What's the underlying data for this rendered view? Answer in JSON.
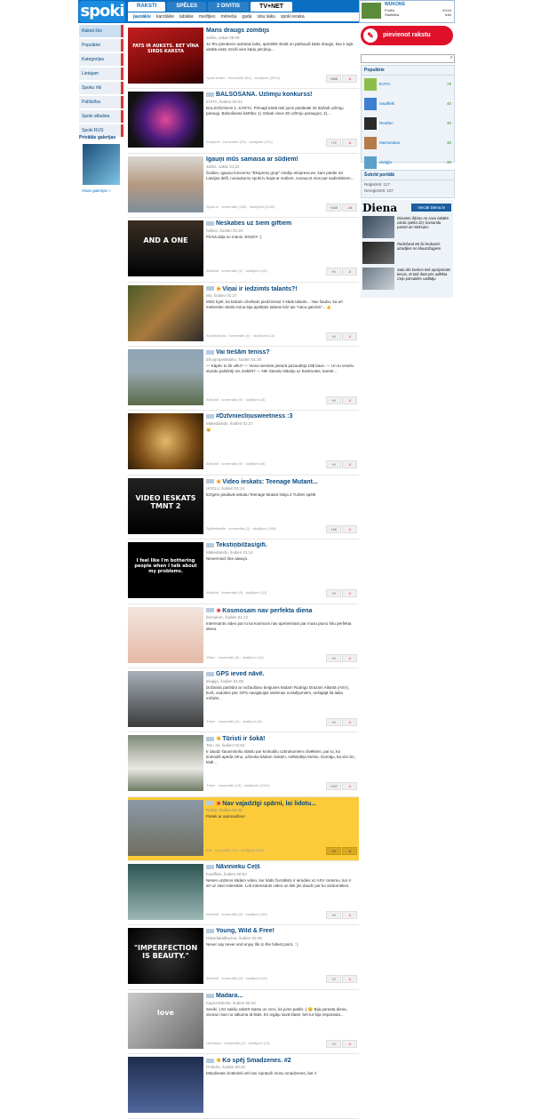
{
  "header": {
    "logo": "spoki",
    "tabs": [
      "RAKSTI",
      "SPĒLES",
      "2 DIVITIS",
      "TV+NET"
    ],
    "subnav": [
      "jaunākie",
      "karstākie",
      "labākie",
      "medījies",
      "mēneša",
      "gada",
      "visu laiku",
      "spoki ieraka"
    ],
    "user": {
      "name": "WUKONS",
      "links": [
        "Profils",
        "Statistika"
      ],
      "count": "6/116",
      "exit": "Iziet"
    }
  },
  "sidebar": {
    "items": [
      "Raksti šīsi",
      "Populārie",
      "Kategorijas",
      "Lietajam",
      "Spoku rīki",
      "Palīdzība",
      "Spoki atbalsta",
      "Spoki RUS"
    ],
    "gallery_title": "Privātās galerijas",
    "gallery_link": "Visas galerijas »"
  },
  "articles": [
    {
      "title": "Mans draugs zombijs",
      "meta": "Jačks, vakar 09:09",
      "text": "Ja Tev pienācies aukstais laiks, apmēklē skolā un pārbaudi kāds draugs, kas ir tajā ideālā vietā. Droši vien kādu pēcdeju...",
      "foot": "Spoki ieaike · komentāri (81) · skatījumi (5014)",
      "up": "+685",
      "down": "-8",
      "icon": "none",
      "thumb": "t1",
      "cap": "FATS IR AUKSTS. BET VĪNA SIRDS KARSTA"
    },
    {
      "title": "BALSOŠANA. Uzlimju konkurss!",
      "meta": "EVITA, šodien 00:31",
      "text": "BALSOŠANAS 1. KĀRTA. Pirmajā kārtā tiek jums piedāvāti 30 dažādi uzlīmju paraugi. Balsošanas kārtība: 1) Izskati visus 30 uzlīmju paraugus; 2)...",
      "foot": "Konkursi · komentāri (30) · skatījumi (101)",
      "up": "+72",
      "down": "-8",
      "icon": "ico",
      "thumb": "t2",
      "cap": ""
    },
    {
      "title": "Igauņi mūs samaisa ar sūdiem!",
      "meta": "Jačks, vakar 21:22",
      "text": "Šodien, igauņu koncerna \"Ekspress grup\" mediju ekspress.ee, kam pieder arī Latvijas delfi, nosaukums spoki.lv kopā ar sūdiem, nosaucot mūs par sadistiskiem...",
      "foot": "Spoki.lv · komentāri (158) · skatījumi (2139)",
      "up": "+183",
      "down": "-16",
      "icon": "none",
      "thumb": "t3",
      "cap": ""
    },
    {
      "title": "Neskaties uz šiem giftiem",
      "meta": "hellion, šodien 01:34",
      "text": "Pirmā daļa no manis. ENJOY :)",
      "foot": "Atlidzīdi · komentāri (0) · skatījumi (15)",
      "up": "+0",
      "down": "-0",
      "icon": "ico",
      "thumb": "t4",
      "cap": "AND A ONE"
    },
    {
      "title": "Viņai ir iedzimts talants?!",
      "meta": "Mo, šodien 01:27",
      "text": "Mīdz byēt, ka katram cilvēkam piedzimstot ir kāds talants... Nav šaubu, ka arī meitenītei vārdā Aviņa bija apslēpts talants līdz tas \"nāca gaismā\"... 👍",
      "foot": "Kineidziņoks · komentāri (0) · skatījumi (14)",
      "up": "+0",
      "down": "-0",
      "icon": "star",
      "thumb": "t5",
      "cap": ""
    },
    {
      "title": "Vai tiešām teniss?",
      "meta": "Zhoojmpeskitako, šodien 01:20",
      "text": "— Kāpēc tu tik vēlu? — Viena sieviete pieturā pazaudēja 10$ latus. — Un tu veselu stundu palīdzēji tos meklēt? — Nē! Stundu stāvēju uz banknotes, kamēr...",
      "foot": "Atlidzīdi · komentāri (0) · skatījumi (3)",
      "up": "+0",
      "down": "-0",
      "icon": "ico",
      "thumb": "t6",
      "cap": ""
    },
    {
      "title": "#Dzīvniecīņusweetness :3",
      "meta": "Makediando, šodien 01:17",
      "text": "😸",
      "foot": "Atlidzīdi · komentāri (0) · skatījumi (8)",
      "up": "+0",
      "down": "-0",
      "icon": "ico",
      "thumb": "t7",
      "cap": ""
    },
    {
      "title": "Video ieskats: Teenage Mutant...",
      "meta": "UOCLV, šodien 01:14",
      "text": "Ezīgers piedāvā ieskatu Teenage Mutant Ninja 2 Turtles spēlē.",
      "foot": "Spēlesblaffe · komentāri (2) · skatījumi (108)",
      "up": "+16",
      "down": "-2",
      "icon": "star",
      "thumb": "t8",
      "cap": "VIDEO IESKATS TMNT 2"
    },
    {
      "title": "Tekstiņbilžas/gifi.",
      "meta": "Makediando, šodien 01:14",
      "text": "Nevermind, like always.",
      "foot": "Atlidzīdi · komentāri (0) · skatījumi (11)",
      "up": "+0",
      "down": "-0",
      "icon": "ico",
      "thumb": "t9",
      "cap": "I feel like I'm bothering people when I talk about my problems."
    },
    {
      "title": "Kosmosam nav perfekta diena",
      "meta": "bezadore, šodien 01:12",
      "text": "Interesants video par to ka kosmoss nav apmierinats par musu jauno hitu perfekta diena.",
      "foot": "Video · komentāri (0) · skatījumi (10)",
      "up": "+0",
      "down": "-0",
      "icon": "redstar",
      "thumb": "t10",
      "cap": ""
    },
    {
      "title": "GPS ieved nāvē.",
      "meta": "alvigija, šodien 01:06",
      "text": "Dožando paslīdot ar nožaušanu beiguses kādam Rodrigo Drazam Atlantā (ASV), kurš, vadoties pēc GPS navigācijas sistēmas norādījumiem, nešajājā šā laika mičalīs...",
      "foot": "Trāne · komentāri (2) · skatījumi (8)",
      "up": "+0",
      "down": "-0",
      "icon": "ico",
      "thumb": "t11",
      "cap": ""
    },
    {
      "title": "Tūristi ir šokā!",
      "meta": "Tas i es, šodien 01:02",
      "text": "Ir daudz šausminošu stāstu par krokodilu uzbrukumiem cilvēkiem, par to, ka krokodili apēda zēnu, uzbruka kādam zivkām, mēbiedējo tūristu. Domāju, ka visi zin, kādi...",
      "foot": "Trāne · komentāri (13) · skatījumi (1312)",
      "up": "+137",
      "down": "-0",
      "icon": "star",
      "thumb": "t12",
      "cap": ""
    },
    {
      "title": "Nav vajadzīgi spārni, lai lidotu...",
      "meta": "Rolcis, šodien 00:45",
      "text": "Patiek ar automašīnu!",
      "foot": "Atlii · komentāri (10) · skatījumi (364)",
      "up": "+0",
      "down": "-0",
      "icon": "redstar",
      "thumb": "t13",
      "cap": "",
      "featured": true
    },
    {
      "title": "Nāvinieku Ceļš",
      "meta": "foxaffisis, šodien 00:53",
      "text": "Nesen uzdūros kādam video, kur kāds žurnālists ir ieradies uz ASV cietumu, kur ir arī uz nāvi notiesātie. Loti interesants video un liek jūs daudz par ko aizdomāties.",
      "foot": "Atlidzīdi · komentāri (0) · skatījumi (34)",
      "up": "+0",
      "down": "-0",
      "icon": "ico",
      "thumb": "t14",
      "cap": ""
    },
    {
      "title": "Young, Wild & Free!",
      "meta": "Glavidakaltbozna, šodien 00:49",
      "text": "Never say never and enjoy life to the fullest point. : )",
      "foot": "Atlidzīdi · komentāri (0) · skatījumi (14)",
      "up": "+2",
      "down": "-0",
      "icon": "ico",
      "thumb": "t15",
      "cap": "\"IMPERFECTION IS BEAUTY.\""
    },
    {
      "title": "Madara...",
      "meta": "KajocetSkolot, šodien 00:43",
      "text": "Sveiki :) Es sakšu rakstīt stastu un ceru, ka jums patiks :) 😊 Bija parasta diena, vismaz man no sākuma tā likās. Es iegāju savā klasē, bet tur bija neparasta...",
      "foot": "Literatūra · komentāri (1) · skatījumi (13)",
      "up": "+2",
      "down": "-0",
      "icon": "ico",
      "thumb": "t16",
      "cap": "love"
    },
    {
      "title": "Ko spēj Smadzenes. #2",
      "meta": "Proferts, šodien 00:40",
      "text": "Mūsdienās zinātnieki vēl nav izpratuši mūsu smadzenes, bet ir",
      "foot": "",
      "up": "",
      "down": "",
      "icon": "star",
      "thumb": "t17",
      "cap": ""
    }
  ],
  "right": {
    "add_button": "pievienot rakstu",
    "search_placeholder": "",
    "popular_title": "Populārie",
    "popular": [
      {
        "name": "EVITA",
        "n": "79"
      },
      {
        "name": "Swaffelk",
        "n": "40"
      },
      {
        "name": "Reuften",
        "n": "40"
      },
      {
        "name": "Mazmeakar",
        "n": "30"
      },
      {
        "name": "alvigija",
        "n": "30"
      }
    ],
    "portal_title": "Šobrīd portālā",
    "portal_lines": [
      "Reģistrēti: 127",
      "Nereģistrēti: 107"
    ],
    "diena_logo": "Diena",
    "diena_button": "Veicak Diena.lv",
    "diena_news": [
      "Dimanto Šķiras no savu labākā vārda spēka Ziņ; komandu pamet arī Aleksans",
      "Radošanā 86 šū brokastis atradījies no klauzūžagiem",
      "Sala tiks bedres tiek apstiprināts tiesas, tā tiek dotā pēc adlēkta Ceļu pārvaldes vadītāju"
    ]
  }
}
